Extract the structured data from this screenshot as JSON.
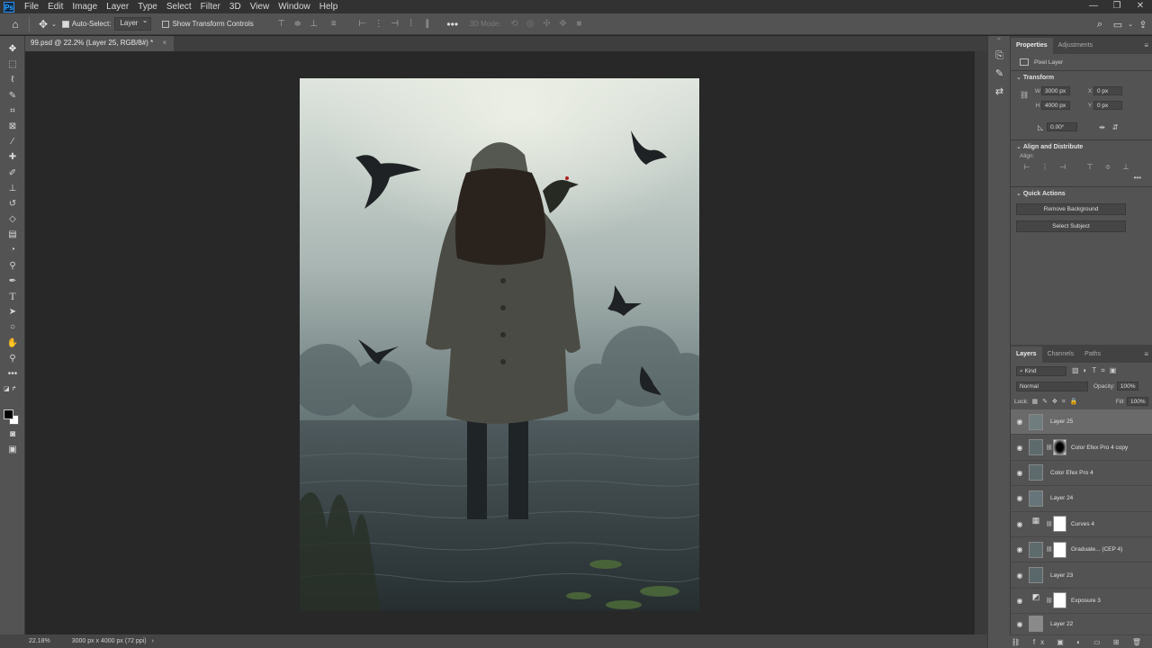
{
  "app": {
    "logo": "Ps",
    "menu": [
      "File",
      "Edit",
      "Image",
      "Layer",
      "Type",
      "Select",
      "Filter",
      "3D",
      "View",
      "Window",
      "Help"
    ]
  },
  "options_bar": {
    "auto_select_label": "Auto-Select:",
    "auto_select_value": "Layer",
    "transform_label": "Show Transform Controls",
    "mode_3d": "3D Mode:"
  },
  "document": {
    "tab_title": "99.psd @ 22.2% (Layer 25, RGB/8#) *",
    "close": "×"
  },
  "status": {
    "zoom": "22.18%",
    "doc_info": "3000 px x 4000 px (72 ppi)"
  },
  "properties": {
    "tabs": [
      "Properties",
      "Adjustments"
    ],
    "layer_kind": "Pixel Layer",
    "transform": {
      "title": "Transform",
      "w_label": "W",
      "w_value": "3000 px",
      "h_label": "H",
      "h_value": "4000 px",
      "x_label": "X",
      "x_value": "0 px",
      "y_label": "Y",
      "y_value": "0 px",
      "angle_value": "0.00°"
    },
    "align": {
      "title": "Align and Distribute",
      "align_label": "Align:"
    },
    "quick_actions": {
      "title": "Quick Actions",
      "remove_bg": "Remove Background",
      "select_subject": "Select Subject"
    }
  },
  "layers_panel": {
    "tabs": [
      "Layers",
      "Channels",
      "Paths"
    ],
    "kind_filter": "Kind",
    "blend_mode": "Normal",
    "opacity_label": "Opacity:",
    "opacity_value": "100%",
    "lock_label": "Lock:",
    "fill_label": "Fill:",
    "fill_value": "100%",
    "layers": [
      {
        "name": "Layer 25"
      },
      {
        "name": "Color Efex Pro 4 copy"
      },
      {
        "name": "Color Efex Pro 4"
      },
      {
        "name": "Layer 24"
      },
      {
        "name": "Curves 4"
      },
      {
        "name": "Graduate... (CEP 4)"
      },
      {
        "name": "Layer 23"
      },
      {
        "name": "Exposure 3"
      },
      {
        "name": "Layer 22"
      }
    ]
  },
  "colors": {
    "accent": "#31a8ff",
    "panel": "#535353",
    "canvas": "#282828"
  }
}
